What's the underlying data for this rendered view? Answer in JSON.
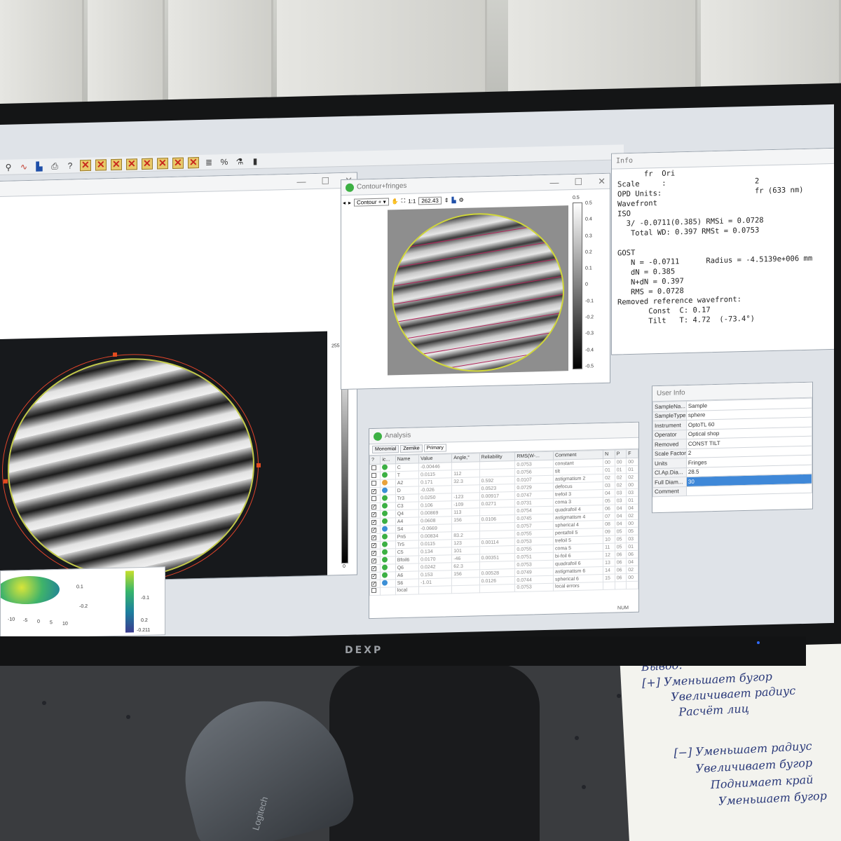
{
  "monitor": {
    "brand": "DEXP"
  },
  "mouse": {
    "brand": "Logitech"
  },
  "toolbar": {
    "icons": [
      "scale-icon",
      "plot-icon",
      "histogram-icon",
      "print-icon",
      "help-icon",
      "remove-term-icon",
      "remove-term-icon",
      "remove-term-icon",
      "remove-term-icon",
      "remove-term-icon",
      "remove-term-icon",
      "remove-term-icon",
      "remove-term-icon",
      "list-icon",
      "percent-icon",
      "filter-icon",
      "battery-icon"
    ]
  },
  "left_window": {
    "colorbar_max": "255",
    "colorbar_min": "0"
  },
  "surface_plot": {
    "ticks": [
      "0.1",
      "-0.1",
      "-0.2",
      "0.2",
      "-0.211"
    ],
    "axis": [
      "-10",
      "-5",
      "0",
      "5",
      "10"
    ]
  },
  "contour_window": {
    "title": "Contour+fringes",
    "mode": "Contour +",
    "zoom_1to1": "1:1",
    "zoom_value": "262.43",
    "left_ticks": [
      "0.5"
    ],
    "right_ticks": [
      "0.5",
      "0.4",
      "0.3",
      "0.2",
      "0.1",
      "0",
      "-0.1",
      "-0.2",
      "-0.3",
      "-0.4",
      "-0.5"
    ]
  },
  "info": {
    "title": "Info",
    "lines": [
      "      fr  Ori",
      "Scale     :                    2",
      "OPD Units:                     fr (633 nm)",
      "Wavefront",
      "ISO",
      "  3/ -0.0711(0.385) RMSi = 0.0728",
      "   Total WD: 0.397 RMSt = 0.0753",
      "",
      "GOST",
      "   N = -0.0711      Radius = -4.5139e+006 mm",
      "   dN = 0.385",
      "   N+dN = 0.397",
      "   RMS = 0.0728",
      "Removed reference wavefront:",
      "       Const  C: 0.17",
      "       Tilt   T: 4.72  (-73.4°)"
    ]
  },
  "user_info": {
    "title": "User Info",
    "rows": [
      {
        "k": "SampleNa...",
        "v": "Sample"
      },
      {
        "k": "SampleType",
        "v": "sphere"
      },
      {
        "k": "Instrument",
        "v": "OptoTL 60"
      },
      {
        "k": "Operator",
        "v": "Optical shop"
      },
      {
        "k": "Removed",
        "v": "CONST TILT"
      },
      {
        "k": "Scale Factor",
        "v": "2"
      },
      {
        "k": "Units",
        "v": "Fringes"
      },
      {
        "k": "Cl.Ap.Dia...",
        "v": "28.5"
      },
      {
        "k": "Full Diam...",
        "v": "30"
      },
      {
        "k": "Comment",
        "v": ""
      }
    ]
  },
  "analysis": {
    "title": "Analysis",
    "tabs": [
      "Monomial",
      "Zernike",
      "Primary"
    ],
    "columns": [
      "?",
      "ic...",
      "Name",
      "Value",
      "Angle,°",
      "Reliability",
      "RMS(W-...",
      "Comment",
      "N",
      "P",
      "F"
    ],
    "rows": [
      {
        "chk": "",
        "icon": "#3cb043",
        "name": "C",
        "value": "-0.00446",
        "angle": "",
        "rel": "",
        "rms": "0.0753",
        "comment": "constant",
        "n": "00",
        "p": "00",
        "f": "00"
      },
      {
        "chk": "",
        "icon": "#3cb043",
        "name": "T",
        "value": "0.0115",
        "angle": "112",
        "rel": "",
        "rms": "0.0756",
        "comment": "tilt",
        "n": "01",
        "p": "01",
        "f": "01"
      },
      {
        "chk": "",
        "icon": "#e9a23b",
        "name": "A2",
        "value": "0.171",
        "angle": "32.3",
        "rel": "0.592",
        "rms": "0.0107",
        "comment": "astigmatism 2",
        "n": "02",
        "p": "02",
        "f": "02"
      },
      {
        "chk": "✓",
        "icon": "#3b8fd6",
        "name": "D",
        "value": "-0.026",
        "angle": "",
        "rel": "0.0523",
        "rms": "0.0729",
        "comment": "defocus",
        "n": "03",
        "p": "02",
        "f": "00"
      },
      {
        "chk": "",
        "icon": "#3cb043",
        "name": "Tr3",
        "value": "0.0250",
        "angle": "-123",
        "rel": "0.00917",
        "rms": "0.0747",
        "comment": "trefoil 3",
        "n": "04",
        "p": "03",
        "f": "03"
      },
      {
        "chk": "✓",
        "icon": "#3cb043",
        "name": "C3",
        "value": "0.106",
        "angle": "-109",
        "rel": "0.0271",
        "rms": "0.0731",
        "comment": "coma 3",
        "n": "05",
        "p": "03",
        "f": "01"
      },
      {
        "chk": "✓",
        "icon": "#3cb043",
        "name": "Q4",
        "value": "0.00869",
        "angle": "113",
        "rel": "",
        "rms": "0.0754",
        "comment": "quadrafoil 4",
        "n": "06",
        "p": "04",
        "f": "04"
      },
      {
        "chk": "✓",
        "icon": "#3cb043",
        "name": "A4",
        "value": "0.0608",
        "angle": "156",
        "rel": "0.0106",
        "rms": "0.0745",
        "comment": "astigmatism 4",
        "n": "07",
        "p": "04",
        "f": "02"
      },
      {
        "chk": "✓",
        "icon": "#3b8fd6",
        "name": "S4",
        "value": "-0.0669",
        "angle": "",
        "rel": "",
        "rms": "0.0757",
        "comment": "spherical 4",
        "n": "08",
        "p": "04",
        "f": "00"
      },
      {
        "chk": "✓",
        "icon": "#3cb043",
        "name": "Pn5",
        "value": "0.00834",
        "angle": "83.2",
        "rel": "",
        "rms": "0.0755",
        "comment": "pentafoil 5",
        "n": "09",
        "p": "05",
        "f": "05"
      },
      {
        "chk": "✓",
        "icon": "#3cb043",
        "name": "Tr5",
        "value": "0.0115",
        "angle": "123",
        "rel": "0.00114",
        "rms": "0.0753",
        "comment": "trefoil 5",
        "n": "10",
        "p": "05",
        "f": "03"
      },
      {
        "chk": "✓",
        "icon": "#3cb043",
        "name": "C5",
        "value": "0.134",
        "angle": "101",
        "rel": "",
        "rms": "0.0755",
        "comment": "coma 5",
        "n": "11",
        "p": "05",
        "f": "01"
      },
      {
        "chk": "✓",
        "icon": "#3cb043",
        "name": "Bfoil6",
        "value": "0.0170",
        "angle": "-46",
        "rel": "0.00351",
        "rms": "0.0751",
        "comment": "bi-foil 6",
        "n": "12",
        "p": "06",
        "f": "06"
      },
      {
        "chk": "✓",
        "icon": "#3cb043",
        "name": "Q6",
        "value": "0.0242",
        "angle": "62.3",
        "rel": "",
        "rms": "0.0753",
        "comment": "quadrafoil 6",
        "n": "13",
        "p": "06",
        "f": "04"
      },
      {
        "chk": "✓",
        "icon": "#3cb043",
        "name": "A6",
        "value": "0.153",
        "angle": "156",
        "rel": "0.00528",
        "rms": "0.0749",
        "comment": "astigmatism 6",
        "n": "14",
        "p": "06",
        "f": "02"
      },
      {
        "chk": "✓",
        "icon": "#3b8fd6",
        "name": "S6",
        "value": "-1.01",
        "angle": "",
        "rel": "0.0126",
        "rms": "0.0744",
        "comment": "spherical 6",
        "n": "15",
        "p": "06",
        "f": "00"
      },
      {
        "chk": "",
        "icon": "",
        "name": "local",
        "value": "",
        "angle": "",
        "rel": "",
        "rms": "0.0753",
        "comment": "local errors",
        "n": "",
        "p": "",
        "f": ""
      }
    ]
  },
  "status": {
    "num": "NUM"
  },
  "notes": {
    "lines": [
      "Вывод:",
      "[+] Уменьшает бугор",
      "Увеличивает радиус",
      "Расчёт лиц",
      "[−] Уменьшает радиус",
      "Увеличивает бугор",
      "Поднимает край",
      "Уменьшает бугор"
    ]
  }
}
